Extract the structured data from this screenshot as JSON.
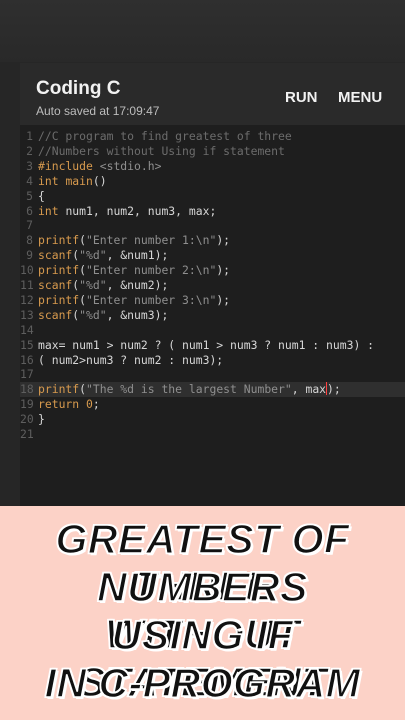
{
  "app": {
    "title": "Coding C",
    "autosave": "Auto saved at 17:09:47",
    "run_label": "RUN",
    "menu_label": "MENU"
  },
  "editor": {
    "active_line": 18,
    "lines": [
      {
        "n": "1",
        "tokens": [
          {
            "t": "//C program to find greatest of three",
            "c": "comment"
          }
        ]
      },
      {
        "n": "2",
        "tokens": [
          {
            "t": "//Numbers without Using if statement",
            "c": "comment"
          }
        ]
      },
      {
        "n": "3",
        "tokens": [
          {
            "t": "#include ",
            "c": "pre"
          },
          {
            "t": "<stdio.h>",
            "c": "str"
          }
        ]
      },
      {
        "n": "4",
        "tokens": [
          {
            "t": "int ",
            "c": "kw"
          },
          {
            "t": "main",
            "c": "fn"
          },
          {
            "t": "()",
            "c": "plain"
          }
        ]
      },
      {
        "n": "5",
        "tokens": [
          {
            "t": "{",
            "c": "plain"
          }
        ]
      },
      {
        "n": "6",
        "tokens": [
          {
            "t": "int ",
            "c": "kw"
          },
          {
            "t": "num1, num2, num3, max;",
            "c": "plain"
          }
        ]
      },
      {
        "n": "7",
        "tokens": []
      },
      {
        "n": "8",
        "tokens": [
          {
            "t": "printf",
            "c": "fn"
          },
          {
            "t": "(",
            "c": "plain"
          },
          {
            "t": "\"Enter number 1:\\n\"",
            "c": "str"
          },
          {
            "t": ");",
            "c": "plain"
          }
        ]
      },
      {
        "n": "9",
        "tokens": [
          {
            "t": "scanf",
            "c": "fn"
          },
          {
            "t": "(",
            "c": "plain"
          },
          {
            "t": "\"%d\"",
            "c": "str"
          },
          {
            "t": ", &num1);",
            "c": "plain"
          }
        ]
      },
      {
        "n": "10",
        "tokens": [
          {
            "t": "printf",
            "c": "fn"
          },
          {
            "t": "(",
            "c": "plain"
          },
          {
            "t": "\"Enter number 2:\\n\"",
            "c": "str"
          },
          {
            "t": ");",
            "c": "plain"
          }
        ]
      },
      {
        "n": "11",
        "tokens": [
          {
            "t": "scanf",
            "c": "fn"
          },
          {
            "t": "(",
            "c": "plain"
          },
          {
            "t": "\"%d\"",
            "c": "str"
          },
          {
            "t": ", &num2);",
            "c": "plain"
          }
        ]
      },
      {
        "n": "12",
        "tokens": [
          {
            "t": "printf",
            "c": "fn"
          },
          {
            "t": "(",
            "c": "plain"
          },
          {
            "t": "\"Enter number 3:\\n\"",
            "c": "str"
          },
          {
            "t": ");",
            "c": "plain"
          }
        ]
      },
      {
        "n": "13",
        "tokens": [
          {
            "t": "scanf",
            "c": "fn"
          },
          {
            "t": "(",
            "c": "plain"
          },
          {
            "t": "\"%d\"",
            "c": "str"
          },
          {
            "t": ", &num3);",
            "c": "plain"
          }
        ]
      },
      {
        "n": "14",
        "tokens": []
      },
      {
        "n": "15",
        "tokens": [
          {
            "t": "max= num1 > num2 ? ( num1 > num3 ? num1 : num3) :",
            "c": "plain"
          }
        ]
      },
      {
        "n": "16",
        "tokens": [
          {
            "t": "( num2>num3 ? num2 : num3);",
            "c": "plain"
          }
        ]
      },
      {
        "n": "17",
        "tokens": []
      },
      {
        "n": "18",
        "tokens": [
          {
            "t": "printf",
            "c": "fn"
          },
          {
            "t": "(",
            "c": "plain"
          },
          {
            "t": "\"The %d is the largest Number\"",
            "c": "str"
          },
          {
            "t": ", max",
            "c": "plain"
          },
          {
            "t": "|caret|",
            "c": "caret"
          },
          {
            "t": ");",
            "c": "plain"
          }
        ]
      },
      {
        "n": "19",
        "tokens": [
          {
            "t": "return ",
            "c": "kw"
          },
          {
            "t": "0",
            "c": "num"
          },
          {
            "t": ";",
            "c": "plain"
          }
        ]
      },
      {
        "n": "20",
        "tokens": [
          {
            "t": "}",
            "c": "plain"
          }
        ]
      },
      {
        "n": "21",
        "tokens": []
      }
    ]
  },
  "caption": {
    "lines": [
      "GREATEST OF THREE",
      "NUMBERS WITHOUT",
      "USING IF STATEMENT",
      "IN C-PROGRAM"
    ],
    "background": "#fcd2c7"
  },
  "colors": {
    "keyword": "#d79a4e",
    "string": "#8f8f8f",
    "comment": "#6c6c6c",
    "text": "#d6d6d6",
    "caret": "#ff4040"
  }
}
